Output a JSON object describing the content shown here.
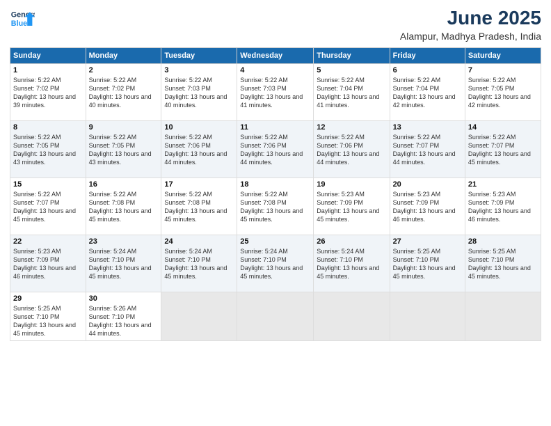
{
  "logo": {
    "line1": "General",
    "line2": "Blue"
  },
  "title": "June 2025",
  "subtitle": "Alampur, Madhya Pradesh, India",
  "weekdays": [
    "Sunday",
    "Monday",
    "Tuesday",
    "Wednesday",
    "Thursday",
    "Friday",
    "Saturday"
  ],
  "weeks": [
    [
      {
        "day": "1",
        "sunrise": "Sunrise: 5:22 AM",
        "sunset": "Sunset: 7:02 PM",
        "daylight": "Daylight: 13 hours and 39 minutes."
      },
      {
        "day": "2",
        "sunrise": "Sunrise: 5:22 AM",
        "sunset": "Sunset: 7:02 PM",
        "daylight": "Daylight: 13 hours and 40 minutes."
      },
      {
        "day": "3",
        "sunrise": "Sunrise: 5:22 AM",
        "sunset": "Sunset: 7:03 PM",
        "daylight": "Daylight: 13 hours and 40 minutes."
      },
      {
        "day": "4",
        "sunrise": "Sunrise: 5:22 AM",
        "sunset": "Sunset: 7:03 PM",
        "daylight": "Daylight: 13 hours and 41 minutes."
      },
      {
        "day": "5",
        "sunrise": "Sunrise: 5:22 AM",
        "sunset": "Sunset: 7:04 PM",
        "daylight": "Daylight: 13 hours and 41 minutes."
      },
      {
        "day": "6",
        "sunrise": "Sunrise: 5:22 AM",
        "sunset": "Sunset: 7:04 PM",
        "daylight": "Daylight: 13 hours and 42 minutes."
      },
      {
        "day": "7",
        "sunrise": "Sunrise: 5:22 AM",
        "sunset": "Sunset: 7:05 PM",
        "daylight": "Daylight: 13 hours and 42 minutes."
      }
    ],
    [
      {
        "day": "8",
        "sunrise": "Sunrise: 5:22 AM",
        "sunset": "Sunset: 7:05 PM",
        "daylight": "Daylight: 13 hours and 43 minutes."
      },
      {
        "day": "9",
        "sunrise": "Sunrise: 5:22 AM",
        "sunset": "Sunset: 7:05 PM",
        "daylight": "Daylight: 13 hours and 43 minutes."
      },
      {
        "day": "10",
        "sunrise": "Sunrise: 5:22 AM",
        "sunset": "Sunset: 7:06 PM",
        "daylight": "Daylight: 13 hours and 44 minutes."
      },
      {
        "day": "11",
        "sunrise": "Sunrise: 5:22 AM",
        "sunset": "Sunset: 7:06 PM",
        "daylight": "Daylight: 13 hours and 44 minutes."
      },
      {
        "day": "12",
        "sunrise": "Sunrise: 5:22 AM",
        "sunset": "Sunset: 7:06 PM",
        "daylight": "Daylight: 13 hours and 44 minutes."
      },
      {
        "day": "13",
        "sunrise": "Sunrise: 5:22 AM",
        "sunset": "Sunset: 7:07 PM",
        "daylight": "Daylight: 13 hours and 44 minutes."
      },
      {
        "day": "14",
        "sunrise": "Sunrise: 5:22 AM",
        "sunset": "Sunset: 7:07 PM",
        "daylight": "Daylight: 13 hours and 45 minutes."
      }
    ],
    [
      {
        "day": "15",
        "sunrise": "Sunrise: 5:22 AM",
        "sunset": "Sunset: 7:07 PM",
        "daylight": "Daylight: 13 hours and 45 minutes."
      },
      {
        "day": "16",
        "sunrise": "Sunrise: 5:22 AM",
        "sunset": "Sunset: 7:08 PM",
        "daylight": "Daylight: 13 hours and 45 minutes."
      },
      {
        "day": "17",
        "sunrise": "Sunrise: 5:22 AM",
        "sunset": "Sunset: 7:08 PM",
        "daylight": "Daylight: 13 hours and 45 minutes."
      },
      {
        "day": "18",
        "sunrise": "Sunrise: 5:22 AM",
        "sunset": "Sunset: 7:08 PM",
        "daylight": "Daylight: 13 hours and 45 minutes."
      },
      {
        "day": "19",
        "sunrise": "Sunrise: 5:23 AM",
        "sunset": "Sunset: 7:09 PM",
        "daylight": "Daylight: 13 hours and 45 minutes."
      },
      {
        "day": "20",
        "sunrise": "Sunrise: 5:23 AM",
        "sunset": "Sunset: 7:09 PM",
        "daylight": "Daylight: 13 hours and 46 minutes."
      },
      {
        "day": "21",
        "sunrise": "Sunrise: 5:23 AM",
        "sunset": "Sunset: 7:09 PM",
        "daylight": "Daylight: 13 hours and 46 minutes."
      }
    ],
    [
      {
        "day": "22",
        "sunrise": "Sunrise: 5:23 AM",
        "sunset": "Sunset: 7:09 PM",
        "daylight": "Daylight: 13 hours and 46 minutes."
      },
      {
        "day": "23",
        "sunrise": "Sunrise: 5:24 AM",
        "sunset": "Sunset: 7:10 PM",
        "daylight": "Daylight: 13 hours and 45 minutes."
      },
      {
        "day": "24",
        "sunrise": "Sunrise: 5:24 AM",
        "sunset": "Sunset: 7:10 PM",
        "daylight": "Daylight: 13 hours and 45 minutes."
      },
      {
        "day": "25",
        "sunrise": "Sunrise: 5:24 AM",
        "sunset": "Sunset: 7:10 PM",
        "daylight": "Daylight: 13 hours and 45 minutes."
      },
      {
        "day": "26",
        "sunrise": "Sunrise: 5:24 AM",
        "sunset": "Sunset: 7:10 PM",
        "daylight": "Daylight: 13 hours and 45 minutes."
      },
      {
        "day": "27",
        "sunrise": "Sunrise: 5:25 AM",
        "sunset": "Sunset: 7:10 PM",
        "daylight": "Daylight: 13 hours and 45 minutes."
      },
      {
        "day": "28",
        "sunrise": "Sunrise: 5:25 AM",
        "sunset": "Sunset: 7:10 PM",
        "daylight": "Daylight: 13 hours and 45 minutes."
      }
    ],
    [
      {
        "day": "29",
        "sunrise": "Sunrise: 5:25 AM",
        "sunset": "Sunset: 7:10 PM",
        "daylight": "Daylight: 13 hours and 45 minutes."
      },
      {
        "day": "30",
        "sunrise": "Sunrise: 5:26 AM",
        "sunset": "Sunset: 7:10 PM",
        "daylight": "Daylight: 13 hours and 44 minutes."
      },
      null,
      null,
      null,
      null,
      null
    ]
  ]
}
